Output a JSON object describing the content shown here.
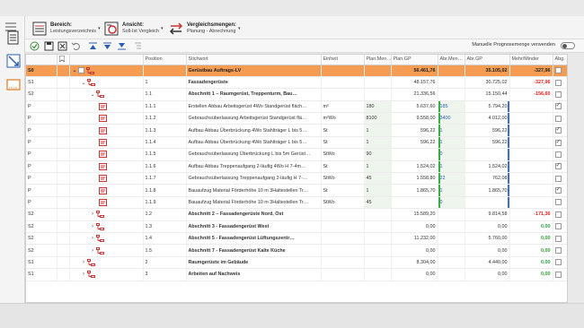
{
  "toolbar": {
    "bereich_title": "Bereich:",
    "bereich_value": "Leistungsverzeichnis",
    "ansicht_title": "Ansicht:",
    "ansicht_value": "Soll-Ist Vergleich",
    "vergleich_title": "Vergleichsmengen:",
    "vergleich_value": "Planung - Abrechnung",
    "toggle_label": "Manuelle Prognosemenge verwenden"
  },
  "columns": [
    "",
    "",
    "",
    "Position",
    "Stichwort",
    "Einheit",
    "Plan.Men…",
    "Plan.GP",
    "Abr.Men…",
    "Abr.GP",
    "Mehr/Minder",
    "Abg."
  ],
  "rows": [
    {
      "lvl": "S0",
      "indent": 0,
      "chev": "v",
      "ico": "tree",
      "pos": "",
      "text": "Gerüstbau Auftrags-LV",
      "unit": "",
      "pm": "",
      "pgp": "56.461,76",
      "am": "",
      "agp": "35.105,02",
      "diff": "-327,96",
      "diffc": "neg",
      "cb": false,
      "style": "lv0"
    },
    {
      "lvl": "S1",
      "indent": 1,
      "chev": "v",
      "ico": "tree",
      "pos": "1",
      "text": "Fassadengerüste",
      "unit": "",
      "pm": "",
      "pgp": "48.157,76",
      "am": "",
      "agp": "30.725,02",
      "diff": "-327,96",
      "diffc": "neg",
      "cb": false,
      "style": "bold"
    },
    {
      "lvl": "S2",
      "indent": 2,
      "chev": "v",
      "ico": "tree",
      "pos": "1.1",
      "text": "Abschnitt 1 – Raumgerüst, Treppenturm, Bau…",
      "unit": "",
      "pm": "",
      "pgp": "21.336,56",
      "am": "",
      "agp": "15.150,44",
      "diff": "-156,60",
      "diffc": "neg",
      "cb": false,
      "style": "bold"
    },
    {
      "lvl": "P",
      "indent": 3,
      "chev": "",
      "ico": "doc",
      "pos": "1.1.1",
      "text": "Erstellen Abbau Arbeitsgerüst 4Wo Standgerüst fläch…",
      "unit": "m²",
      "pm": "180",
      "pgp": "5.637,60",
      "am": "185",
      "agp": "5.794,20",
      "diff": "",
      "diffc": "",
      "cb": true,
      "style": ""
    },
    {
      "lvl": "P",
      "indent": 3,
      "chev": "",
      "ico": "doc",
      "pos": "1.1.2",
      "text": "Gebrauchsüberlassung Arbeitsgerüst Standgerüst flä…",
      "unit": "m²Wo",
      "pm": "8100",
      "pgp": "9.558,00",
      "am": "3400",
      "agp": "4.012,00",
      "diff": "",
      "diffc": "",
      "cb": false,
      "style": ""
    },
    {
      "lvl": "P",
      "indent": 3,
      "chev": "",
      "ico": "doc",
      "pos": "1.1.3",
      "text": "Aufbau Abbau Überbrückung 4Wo Stahlträger L bis 5…",
      "unit": "St",
      "pm": "1",
      "pgp": "596,22",
      "am": "1",
      "agp": "596,22",
      "diff": "",
      "diffc": "",
      "cb": true,
      "style": ""
    },
    {
      "lvl": "P",
      "indent": 3,
      "chev": "",
      "ico": "doc",
      "pos": "1.1.4",
      "text": "Aufbau Abbau Überbrückung 4Wo Stahlträger L bis 5…",
      "unit": "St",
      "pm": "1",
      "pgp": "596,22",
      "am": "1",
      "agp": "596,22",
      "diff": "",
      "diffc": "",
      "cb": true,
      "style": ""
    },
    {
      "lvl": "P",
      "indent": 3,
      "chev": "",
      "ico": "doc",
      "pos": "1.1.5",
      "text": "Gebrauchsüberlassung Überbrückung L bis 5m Gerüst…",
      "unit": "StWo",
      "pm": "90",
      "pgp": "",
      "am": "0",
      "agp": "",
      "diff": "",
      "diffc": "",
      "cb": false,
      "style": ""
    },
    {
      "lvl": "P",
      "indent": 3,
      "chev": "",
      "ico": "doc",
      "pos": "1.1.6",
      "text": "Aufbau Abbau Treppenaufgang 2-läufig 4Wo H 7-4m…",
      "unit": "St",
      "pm": "1",
      "pgp": "1.524,02",
      "am": "1",
      "agp": "1.524,02",
      "diff": "",
      "diffc": "",
      "cb": true,
      "style": ""
    },
    {
      "lvl": "P",
      "indent": 3,
      "chev": "",
      "ico": "doc",
      "pos": "1.1.7",
      "text": "Gebrauchsüberlassung Treppenaufgang 2-läufig H 7-…",
      "unit": "StWo",
      "pm": "45",
      "pgp": "1.558,80",
      "am": "22",
      "agp": "762,08",
      "diff": "",
      "diffc": "",
      "cb": false,
      "style": ""
    },
    {
      "lvl": "P",
      "indent": 3,
      "chev": "",
      "ico": "doc",
      "pos": "1.1.8",
      "text": "Bauaufzug Material Förderhöhe 10 m 3Haltestellen Tr…",
      "unit": "St",
      "pm": "1",
      "pgp": "1.865,70",
      "am": "1",
      "agp": "1.865,70",
      "diff": "",
      "diffc": "",
      "cb": true,
      "style": ""
    },
    {
      "lvl": "P",
      "indent": 3,
      "chev": "",
      "ico": "doc",
      "pos": "1.1.9",
      "text": "Bauaufzug Material Förderhöhe 10 m 3Haltestellen Tr…",
      "unit": "StWo",
      "pm": "45",
      "pgp": "",
      "am": "0",
      "agp": "",
      "diff": "",
      "diffc": "",
      "cb": false,
      "style": ""
    },
    {
      "lvl": "S2",
      "indent": 2,
      "chev": ">",
      "ico": "tree",
      "pos": "1.2",
      "text": "Abschnitt 2 – Fassadengerüste Nord, Ost",
      "unit": "",
      "pm": "",
      "pgp": "15.589,20",
      "am": "",
      "agp": "9.814,58",
      "diff": "-171,36",
      "diffc": "neg",
      "cb": false,
      "style": "bold"
    },
    {
      "lvl": "S2",
      "indent": 2,
      "chev": ">",
      "ico": "tree",
      "pos": "1.3",
      "text": "Abschnitt 3 - Fassadengerüst West",
      "unit": "",
      "pm": "",
      "pgp": "0,00",
      "am": "",
      "agp": "0,00",
      "diff": "0,00",
      "diffc": "pos",
      "cb": false,
      "style": "bold"
    },
    {
      "lvl": "S2",
      "indent": 2,
      "chev": ">",
      "ico": "tree",
      "pos": "1.4",
      "text": "Abschnitt 5 - Fassadengerüst Lüftungszentr…",
      "unit": "",
      "pm": "",
      "pgp": "11.232,00",
      "am": "",
      "agp": "5.760,00",
      "diff": "0,00",
      "diffc": "pos",
      "cb": false,
      "style": "bold"
    },
    {
      "lvl": "S2",
      "indent": 2,
      "chev": ">",
      "ico": "tree",
      "pos": "1.5",
      "text": "Abschnitt 7 - Fassadengerüst Kalte Küche",
      "unit": "",
      "pm": "",
      "pgp": "0,00",
      "am": "",
      "agp": "0,00",
      "diff": "0,00",
      "diffc": "pos",
      "cb": false,
      "style": "bold"
    },
    {
      "lvl": "S1",
      "indent": 1,
      "chev": ">",
      "ico": "tree",
      "pos": "2",
      "text": "Raumgerüste im Gebäude",
      "unit": "",
      "pm": "",
      "pgp": "8.304,00",
      "am": "",
      "agp": "4.440,00",
      "diff": "0,00",
      "diffc": "pos",
      "cb": false,
      "style": "bold"
    },
    {
      "lvl": "S1",
      "indent": 1,
      "chev": ">",
      "ico": "tree",
      "pos": "3",
      "text": "Arbeiten auf Nachweis",
      "unit": "",
      "pm": "",
      "pgp": "0,00",
      "am": "",
      "agp": "0,00",
      "diff": "0,00",
      "diffc": "pos",
      "cb": false,
      "style": "bold"
    }
  ]
}
